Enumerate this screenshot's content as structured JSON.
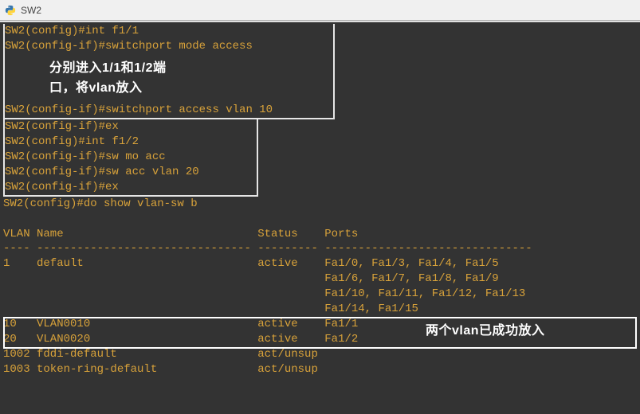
{
  "window": {
    "title": "SW2"
  },
  "lines": {
    "l1": "SW2(config)#int f1/1",
    "l2": "SW2(config-if)#switchport mode access",
    "l3": "SW2(config-if)#switchport access vlan 10",
    "l4": "SW2(config-if)#ex",
    "l5": "SW2(config)#int f1/2",
    "l6": "SW2(config-if)#sw mo acc",
    "l7": "SW2(config-if)#sw acc vlan 20",
    "l8": "SW2(config-if)#ex",
    "l9": "SW2(config)#do show vlan-sw b"
  },
  "annotations": {
    "a1_line1": "分别进入1/1和1/2端",
    "a1_line2": "口，将vlan放入",
    "a2": "两个vlan已成功放入"
  },
  "table": {
    "header": "VLAN Name                             Status    Ports",
    "sep": "---- -------------------------------- --------- -------------------------------",
    "r1": "1    default                          active    Fa1/0, Fa1/3, Fa1/4, Fa1/5",
    "r1b": "                                                Fa1/6, Fa1/7, Fa1/8, Fa1/9",
    "r1c": "                                                Fa1/10, Fa1/11, Fa1/12, Fa1/13",
    "r1d": "                                                Fa1/14, Fa1/15",
    "r2": "10   VLAN0010                         active    Fa1/1",
    "r3": "20   VLAN0020                         active    Fa1/2",
    "r4": "1002 fddi-default                     act/unsup",
    "r5": "1003 token-ring-default               act/unsup"
  }
}
